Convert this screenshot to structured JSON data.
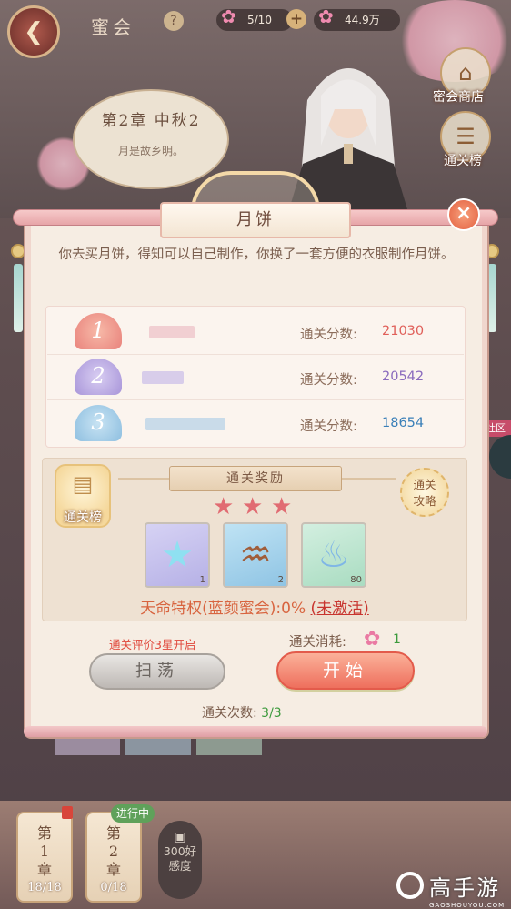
{
  "topbar": {
    "title": "蜜会",
    "help_glyph": "?",
    "stamina": "5/10",
    "currency": "44.9万",
    "plus_glyph": "+"
  },
  "side_buttons": {
    "shop_label": "密会商店",
    "leaderboard_label": "通关榜",
    "community_label": "社区"
  },
  "chapter": {
    "title": "第2章  中秋2",
    "subtitle": "月是故乡明。"
  },
  "dialog": {
    "title": "月饼",
    "close_glyph": "×",
    "description": "你去买月饼，得知可以自己制作，你换了一套方便的衣服制作月饼。",
    "ranking": [
      {
        "rank": "1",
        "score_label": "通关分数:",
        "score": "21030"
      },
      {
        "rank": "2",
        "score_label": "通关分数:",
        "score": "20542"
      },
      {
        "rank": "3",
        "score_label": "通关分数:",
        "score": "18654"
      }
    ],
    "reward_title": "通关奖励",
    "leaderboard_chip": "通关榜",
    "guide_line1": "通关",
    "guide_line2": "攻略",
    "stars": [
      "★",
      "★",
      "★"
    ],
    "items": [
      {
        "name": "star-crystal",
        "count": "1"
      },
      {
        "name": "hair-comb",
        "count": "2"
      },
      {
        "name": "perfume-bottle",
        "count": "80"
      }
    ],
    "privilege_text": "天命特权(蓝颜蜜会):0%",
    "privilege_status": "(未激活)",
    "sweep_hint": "通关评价3星开启",
    "cost_label": "通关消耗:",
    "cost_value": "1",
    "sweep_button": "扫荡",
    "start_button": "开始",
    "clear_count_label": "通关次数:",
    "clear_count_value": "3/3"
  },
  "bottom": {
    "chapter1": {
      "line1": "第",
      "line2": "1",
      "line3": "章",
      "progress": "18/18"
    },
    "chapter2": {
      "line1": "第",
      "line2": "2",
      "line3": "章",
      "progress": "0/18",
      "badge": "进行中"
    },
    "locked": {
      "line1": "300好",
      "line2": "感度"
    }
  },
  "watermark": {
    "title": "高手游",
    "subtitle": "GAOSHOUYOU.COM"
  },
  "colors": {
    "accent_red": "#e76d4c",
    "score_1": "#e0605a",
    "score_2": "#8a6bbd",
    "score_3": "#3a7fb8",
    "green_value": "#3c9a3c"
  }
}
